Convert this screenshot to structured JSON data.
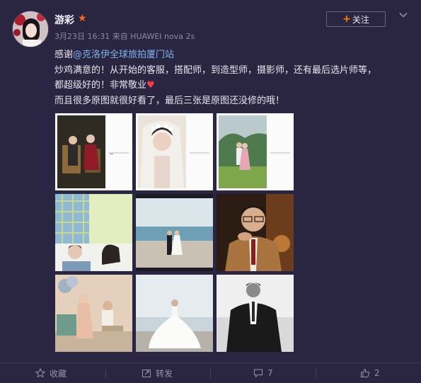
{
  "post": {
    "username": "游彩",
    "meta": "3月23日 16:31 来自 HUAWEI nova 2s",
    "follow_label": "关注",
    "lines": {
      "thanks": "感谢",
      "mention": "@克洛伊全球旅拍厦门站",
      "line2": "炒鸡满意的！从开始的客服，搭配师，到造型师，摄影师，还有最后选片师等，",
      "line3": "都超级好的！非常敬业",
      "line4": "而且很多原图就很好看了，最后三张是原图还没修的哦！"
    },
    "photos": [
      {
        "desc": "studio-couple-chairs"
      },
      {
        "desc": "bride-veil-flowers"
      },
      {
        "desc": "outdoor-couple-mountain"
      },
      {
        "desc": "couple-lying-plaid"
      },
      {
        "desc": "beach-couple"
      },
      {
        "desc": "man-portrait-glasses"
      },
      {
        "desc": "living-room-couple"
      },
      {
        "desc": "white-gown-beach"
      },
      {
        "desc": "man-suit-bw"
      }
    ]
  },
  "footer": {
    "favorite": "收藏",
    "repost": "转发",
    "comments": "7",
    "likes": "2"
  },
  "colors": {
    "background": "#2a2540",
    "link": "#7fb2ec",
    "accent": "#ff8200",
    "heart": "#ff3b46",
    "muted": "#8f89a6"
  }
}
